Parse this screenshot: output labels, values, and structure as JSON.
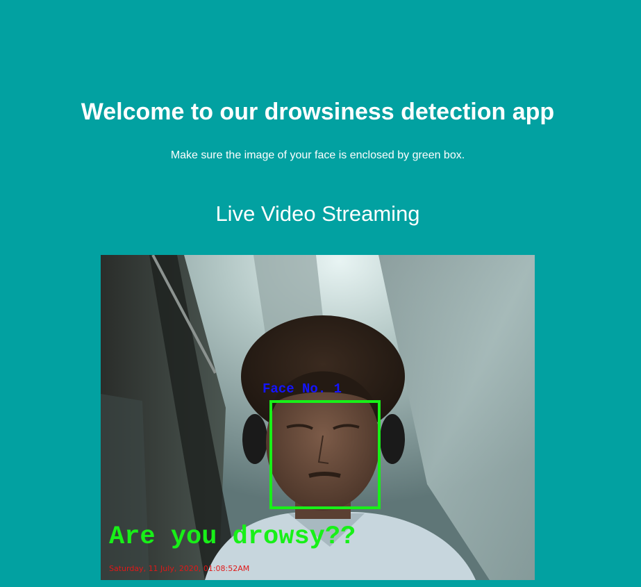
{
  "page": {
    "title": "Welcome to our drowsiness detection app",
    "instruction": "Make sure the image of your face is enclosed by green box."
  },
  "stream": {
    "heading": "Live Video Streaming",
    "overlay": {
      "face_label": "Face No. 1",
      "alert_text": "Are you drowsy??",
      "timestamp": "Saturday, 11 July, 2020, 01:08:52AM"
    }
  },
  "colors": {
    "background": "#02a1a1",
    "face_box": "#18f018",
    "face_label": "#1414ff",
    "alert_text": "#18f018",
    "timestamp": "#e01818"
  }
}
